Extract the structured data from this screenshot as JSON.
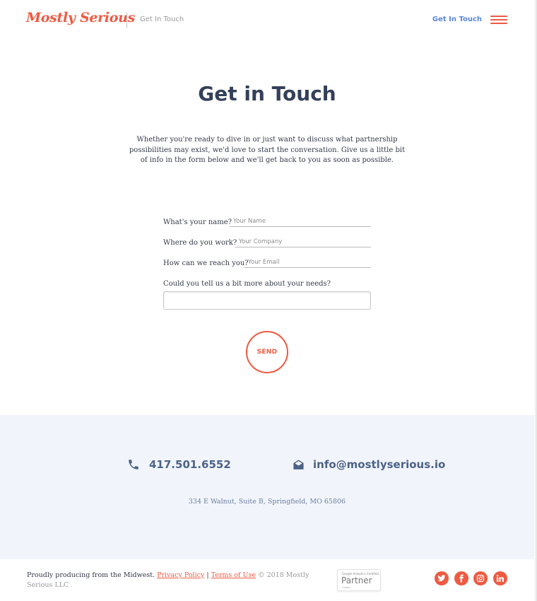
{
  "header": {
    "logo_text": "Mostly Serious",
    "breadcrumb": "Get In Touch",
    "nav_link": "Get In Touch",
    "menu_icon": "hamburger-icon"
  },
  "main": {
    "title": "Get in Touch",
    "intro": "Whether you're ready to dive in or just want to discuss what partnership possibilities may exist, we'd love to start the conversation. Give us a little bit of info in the form below and we'll get back to you as soon as possible."
  },
  "form": {
    "name_label": "What's your name?",
    "name_placeholder": "Your Name",
    "company_label": "Where do you work?",
    "company_placeholder": "Your Company",
    "email_label": "How can we reach you?",
    "email_placeholder": "Your Email",
    "needs_label": "Could you tell us a bit more about your needs?",
    "send_label": "SEND"
  },
  "contact": {
    "phone_icon": "phone-icon",
    "phone": "417.501.6552",
    "email_icon": "envelope-open-icon",
    "email": "info@mostlyserious.io",
    "address": "334 E Walnut, Suite B, Springfield, MO 65806"
  },
  "footer": {
    "tagline": "Proudly producing from the Midwest.",
    "privacy_link": "Privacy Policy",
    "separator": "|",
    "terms_link": "Terms of Use",
    "copyright": "© 2018 Mostly Serious LLC",
    "badge_small": "Google Analytics Certified",
    "badge_big": "Partner",
    "badge_tiny": "Google",
    "social": [
      "twitter-icon",
      "facebook-icon",
      "instagram-icon",
      "linkedin-icon"
    ]
  },
  "colors": {
    "accent": "#ee5a42",
    "link_blue": "#5b86d6",
    "heading": "#34405a",
    "contact_text": "#4d6287",
    "band_bg": "#f1f5fb"
  }
}
